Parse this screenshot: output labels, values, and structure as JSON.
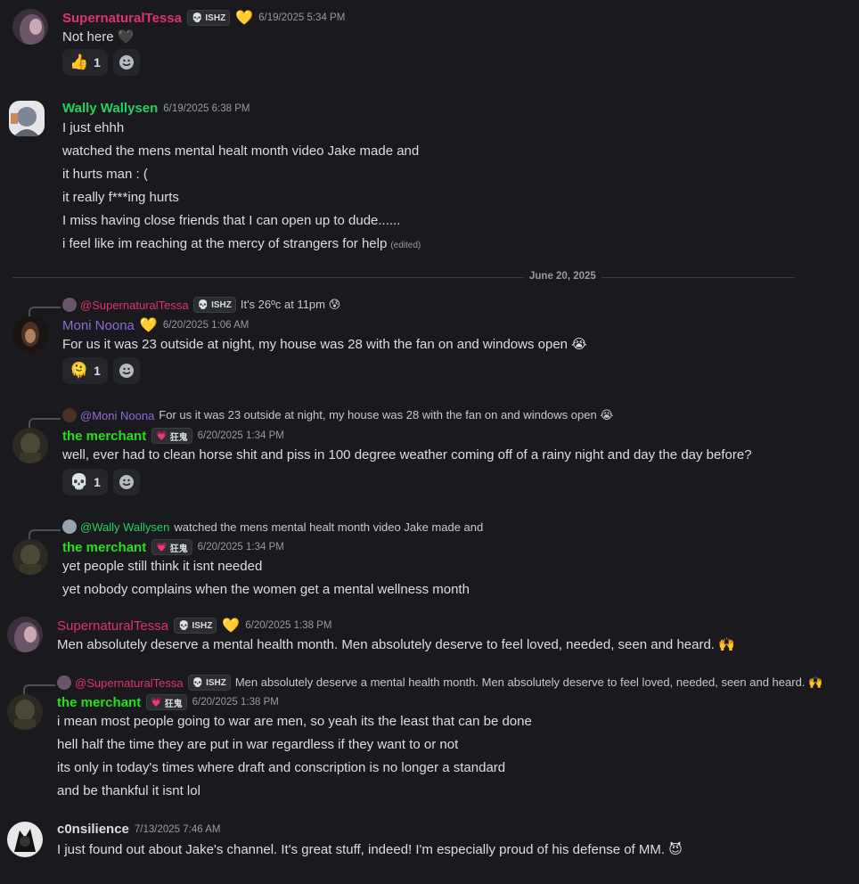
{
  "messages": [
    {
      "author": "SupernaturalTessa",
      "badge": "ISHZ",
      "badge_icon": "skull-icon",
      "heart": "💛",
      "timestamp": "6/19/2025 5:34 PM",
      "lines": [
        "Not here 🖤"
      ],
      "reactions": [
        {
          "emoji": "👍",
          "count": "1"
        }
      ]
    },
    {
      "author": "Wally Wallysen",
      "timestamp": "6/19/2025 6:38 PM",
      "lines": [
        "I just ehhh",
        "watched the mens mental healt month video Jake made and",
        "it hurts man : (",
        "it really f***ing hurts",
        "I miss having close friends that I can open up to dude......",
        "i feel like im reaching at the mercy of strangers for help"
      ],
      "edited": "(edited)"
    },
    {
      "reply_to": {
        "author": "@SupernaturalTessa",
        "badge": "ISHZ",
        "text": "It's 26ºc at 11pm 😰"
      },
      "author": "Moni Noona",
      "heart": "💛",
      "timestamp": "6/20/2025 1:06 AM",
      "lines": [
        "For us it was 23 outside at night, my house was 28 with the fan on and windows open 😭"
      ],
      "reactions": [
        {
          "emoji": "🫠",
          "count": "1"
        }
      ]
    },
    {
      "reply_to": {
        "author": "@Moni Noona",
        "text": "For us it was 23 outside at night, my house was 28 with the fan on and windows open 😭"
      },
      "author": "the merchant",
      "badge": "狂鬼",
      "timestamp": "6/20/2025 1:34 PM",
      "lines": [
        "well, ever had to clean horse shit and piss in 100 degree weather coming off of a rainy night and day the day before?"
      ],
      "reactions": [
        {
          "emoji": "💀",
          "count": "1"
        }
      ]
    },
    {
      "reply_to": {
        "author": "@Wally Wallysen",
        "text": "watched the mens mental healt month video Jake made and"
      },
      "author": "the merchant",
      "badge": "狂鬼",
      "timestamp": "6/20/2025 1:34 PM",
      "lines": [
        "yet people still think it isnt needed",
        "yet nobody complains when the women get a mental wellness month"
      ]
    },
    {
      "author": "SupernaturalTessa",
      "badge": "ISHZ",
      "heart": "💛",
      "timestamp": "6/20/2025 1:38 PM",
      "lines": [
        "Men absolutely deserve a mental health month. Men absolutely deserve to feel loved, needed, seen and heard. 🙌"
      ]
    },
    {
      "reply_to": {
        "author": "@SupernaturalTessa",
        "badge": "ISHZ",
        "text": "Men absolutely deserve a mental health month. Men absolutely deserve to feel loved, needed, seen and heard. 🙌"
      },
      "author": "the merchant",
      "badge": "狂鬼",
      "timestamp": "6/20/2025 1:38 PM",
      "lines": [
        "i mean most people going to war are men, so yeah its the least that can be done",
        "hell half the time they are put in war regardless if they want to or not",
        "its only in today's times where draft and conscription is no longer a standard",
        "and be thankful it isnt lol"
      ]
    },
    {
      "author": "c0nsilience",
      "timestamp": "7/13/2025 7:46 AM",
      "lines": [
        "I just found out about Jake's channel. It's great stuff, indeed! I'm especially proud of his defense of MM. 😈"
      ]
    }
  ],
  "date_divider": "June 20, 2025",
  "colors": {
    "background": "#1a1a1e",
    "tessa": "#e0336b",
    "wally": "#23d160",
    "moni": "#8c6bd6",
    "merchant": "#22e11a"
  }
}
